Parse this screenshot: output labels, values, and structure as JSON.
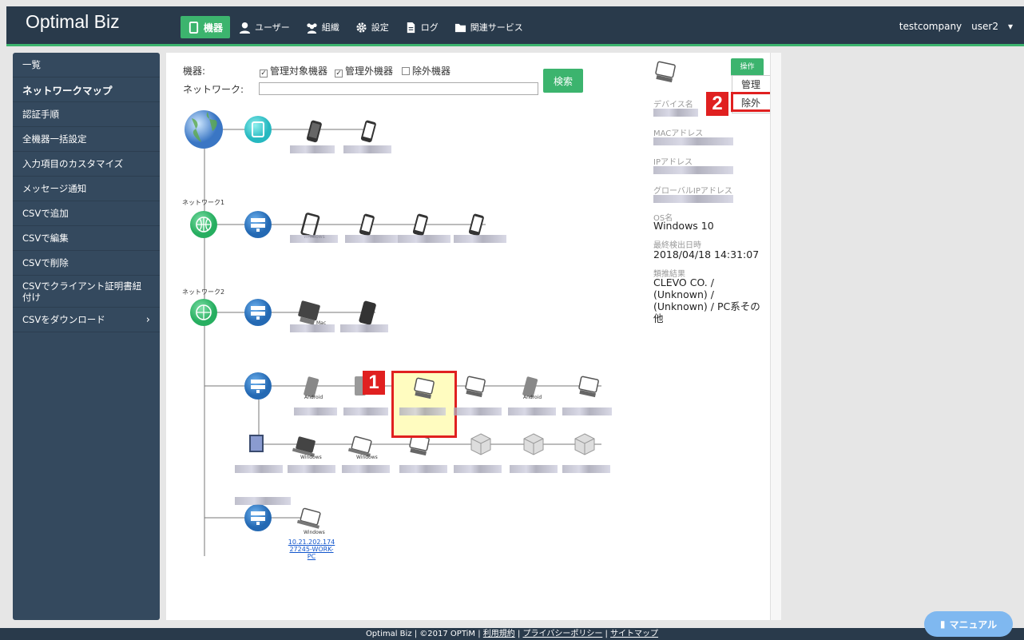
{
  "app": {
    "title": "Optimal Biz"
  },
  "nav": {
    "items": [
      {
        "label": "機器",
        "icon": "phone-icon"
      },
      {
        "label": "ユーザー",
        "icon": "user-icon"
      },
      {
        "label": "組織",
        "icon": "group-icon"
      },
      {
        "label": "設定",
        "icon": "gear-icon"
      },
      {
        "label": "ログ",
        "icon": "document-icon"
      },
      {
        "label": "関連サービス",
        "icon": "folder-icon"
      }
    ],
    "company": "testcompany",
    "user": "user2"
  },
  "sidebar": {
    "items": [
      {
        "label": "一覧"
      },
      {
        "label": "ネットワークマップ"
      },
      {
        "label": "認証手順"
      },
      {
        "label": "全機器一括設定"
      },
      {
        "label": "入力項目のカスタマイズ"
      },
      {
        "label": "メッセージ通知"
      },
      {
        "label": "CSVで追加"
      },
      {
        "label": "CSVで編集"
      },
      {
        "label": "CSVで削除"
      },
      {
        "label": "CSVでクライアント証明書紐付け"
      },
      {
        "label": "CSVをダウンロード"
      }
    ]
  },
  "filter": {
    "device_label": "機器:",
    "network_label": "ネットワーク:",
    "checkboxes": [
      {
        "label": "管理対象機器",
        "checked": true
      },
      {
        "label": "管理外機器",
        "checked": true
      },
      {
        "label": "除外機器",
        "checked": false
      }
    ],
    "search_button": "検索"
  },
  "map": {
    "network1": "ネットワーク1",
    "network2": "ネットワーク2",
    "tag_windows": "Windows",
    "tag_mac": "Mac",
    "tag_android": "Android",
    "linked_device": [
      "10.21.202.174",
      "27245-WORK-",
      "PC"
    ]
  },
  "details": {
    "operation_button": "操作",
    "menu_manage": "管理",
    "menu_exclude": "除外",
    "device_name_label": "デバイス名",
    "mac_label": "MACアドレス",
    "ip_label": "IPアドレス",
    "global_ip_label": "グローバルIPアドレス",
    "os_label": "OS名",
    "os_value": "Windows 10",
    "last_detected_label": "最終検出日時",
    "last_detected_value": "2018/04/18 14:31:07",
    "inference_label": "類推結果",
    "inference_value": "CLEVO CO. / (Unknown) / (Unknown) / PC系その他"
  },
  "annotations": {
    "badge1": "1",
    "badge2": "2"
  },
  "footer": {
    "text": "Optimal Biz | ©2017 OPTiM |",
    "terms": "利用規約",
    "privacy": "プライバシーポリシー",
    "sitemap": "サイトマップ"
  },
  "manual_button": "マニュアル",
  "colors": {
    "topbar": "#293a4b",
    "accent": "#3cb46e",
    "sidebar": "#34495e",
    "annotation_red": "#e02020"
  }
}
